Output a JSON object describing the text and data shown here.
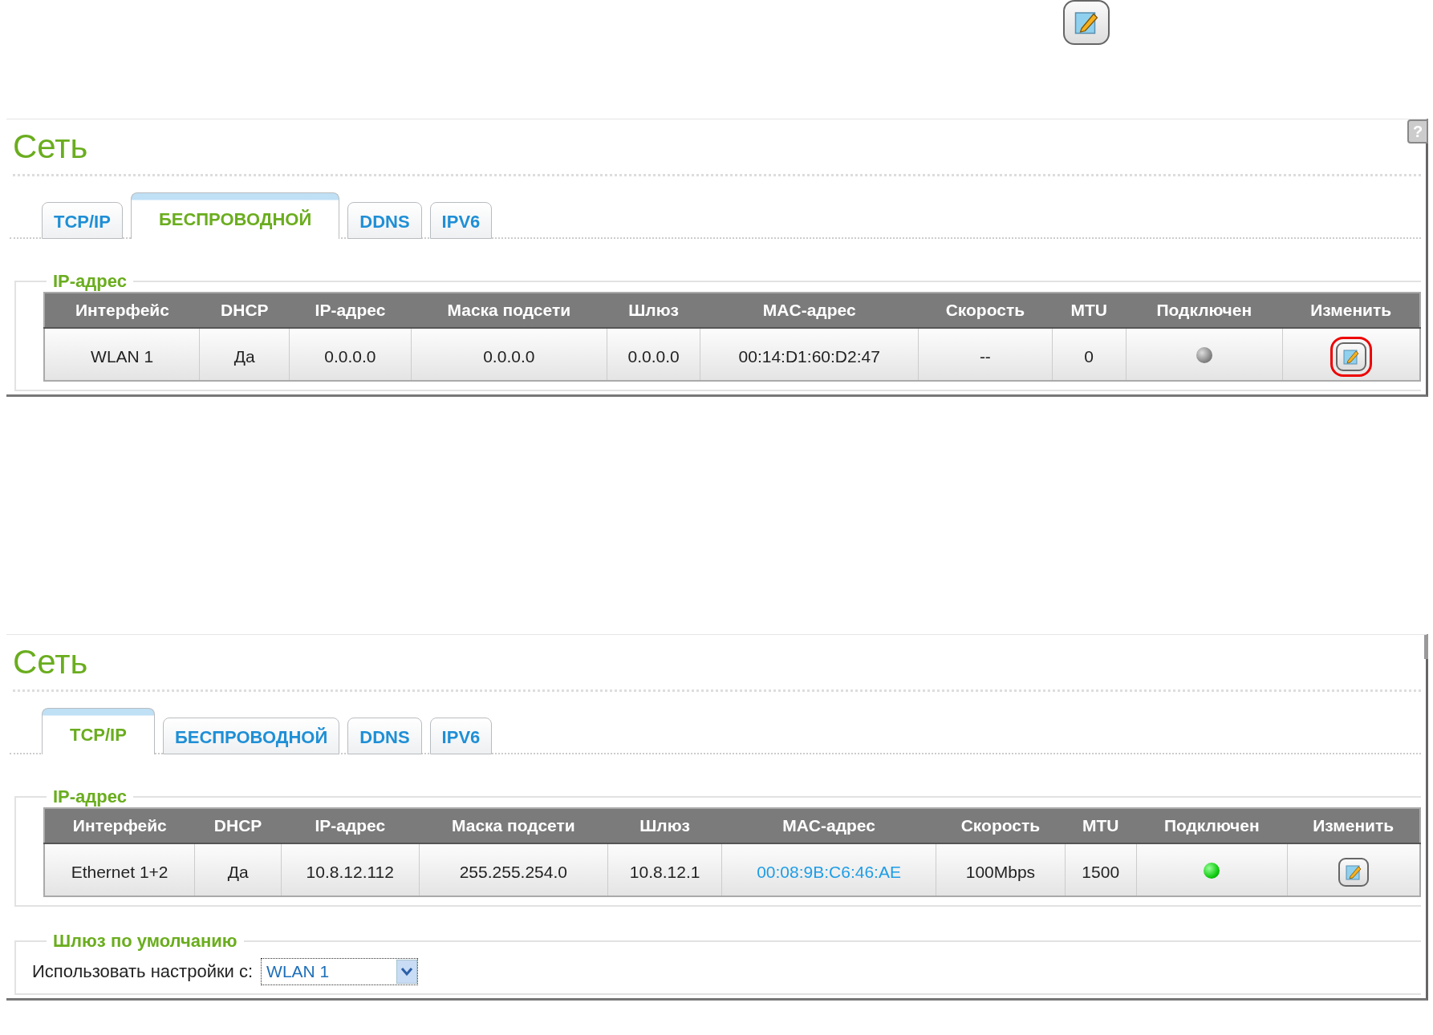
{
  "panels": [
    {
      "title": "Сеть",
      "help": {
        "kind": "full",
        "label": "?"
      },
      "tabs": [
        {
          "label": "TCP/IP",
          "selected": false
        },
        {
          "label": "БЕСПРОВОДНОЙ",
          "selected": true
        },
        {
          "label": "DDNS",
          "selected": false
        },
        {
          "label": "IPV6",
          "selected": false
        }
      ],
      "section_title": "IP-адрес",
      "table": {
        "columns": [
          "Интерфейс",
          "DHCP",
          "IP-адрес",
          "Маска подсети",
          "Шлюз",
          "MAC-адрес",
          "Скорость",
          "MTU",
          "Подключен",
          "Изменить"
        ],
        "rows": [
          {
            "interface": "WLAN 1",
            "dhcp": "Да",
            "ip": "0.0.0.0",
            "mask": "0.0.0.0",
            "gateway": "0.0.0.0",
            "mac": "00:14:D1:60:D2:47",
            "mac_link": false,
            "speed": "--",
            "mtu": "0",
            "connected": false,
            "edit_highlighted": true
          }
        ]
      }
    },
    {
      "title": "Сеть",
      "help": {
        "kind": "cut"
      },
      "tabs": [
        {
          "label": "TCP/IP",
          "selected": true
        },
        {
          "label": "БЕСПРОВОДНОЙ",
          "selected": false
        },
        {
          "label": "DDNS",
          "selected": false
        },
        {
          "label": "IPV6",
          "selected": false
        }
      ],
      "section_title": "IP-адрес",
      "table": {
        "columns": [
          "Интерфейс",
          "DHCP",
          "IP-адрес",
          "Маска подсети",
          "Шлюз",
          "MAC-адрес",
          "Скорость",
          "MTU",
          "Подключен",
          "Изменить"
        ],
        "rows": [
          {
            "interface": "Ethernet 1+2",
            "dhcp": "Да",
            "ip": "10.8.12.112",
            "mask": "255.255.254.0",
            "gateway": "10.8.12.1",
            "mac": "00:08:9B:C6:46:AE",
            "mac_link": true,
            "speed": "100Mbps",
            "mtu": "1500",
            "connected": true,
            "edit_highlighted": false
          }
        ]
      },
      "default_gateway": {
        "title": "Шлюз по умолчанию",
        "label": "Использовать настройки с:",
        "value": "WLAN 1"
      }
    }
  ]
}
